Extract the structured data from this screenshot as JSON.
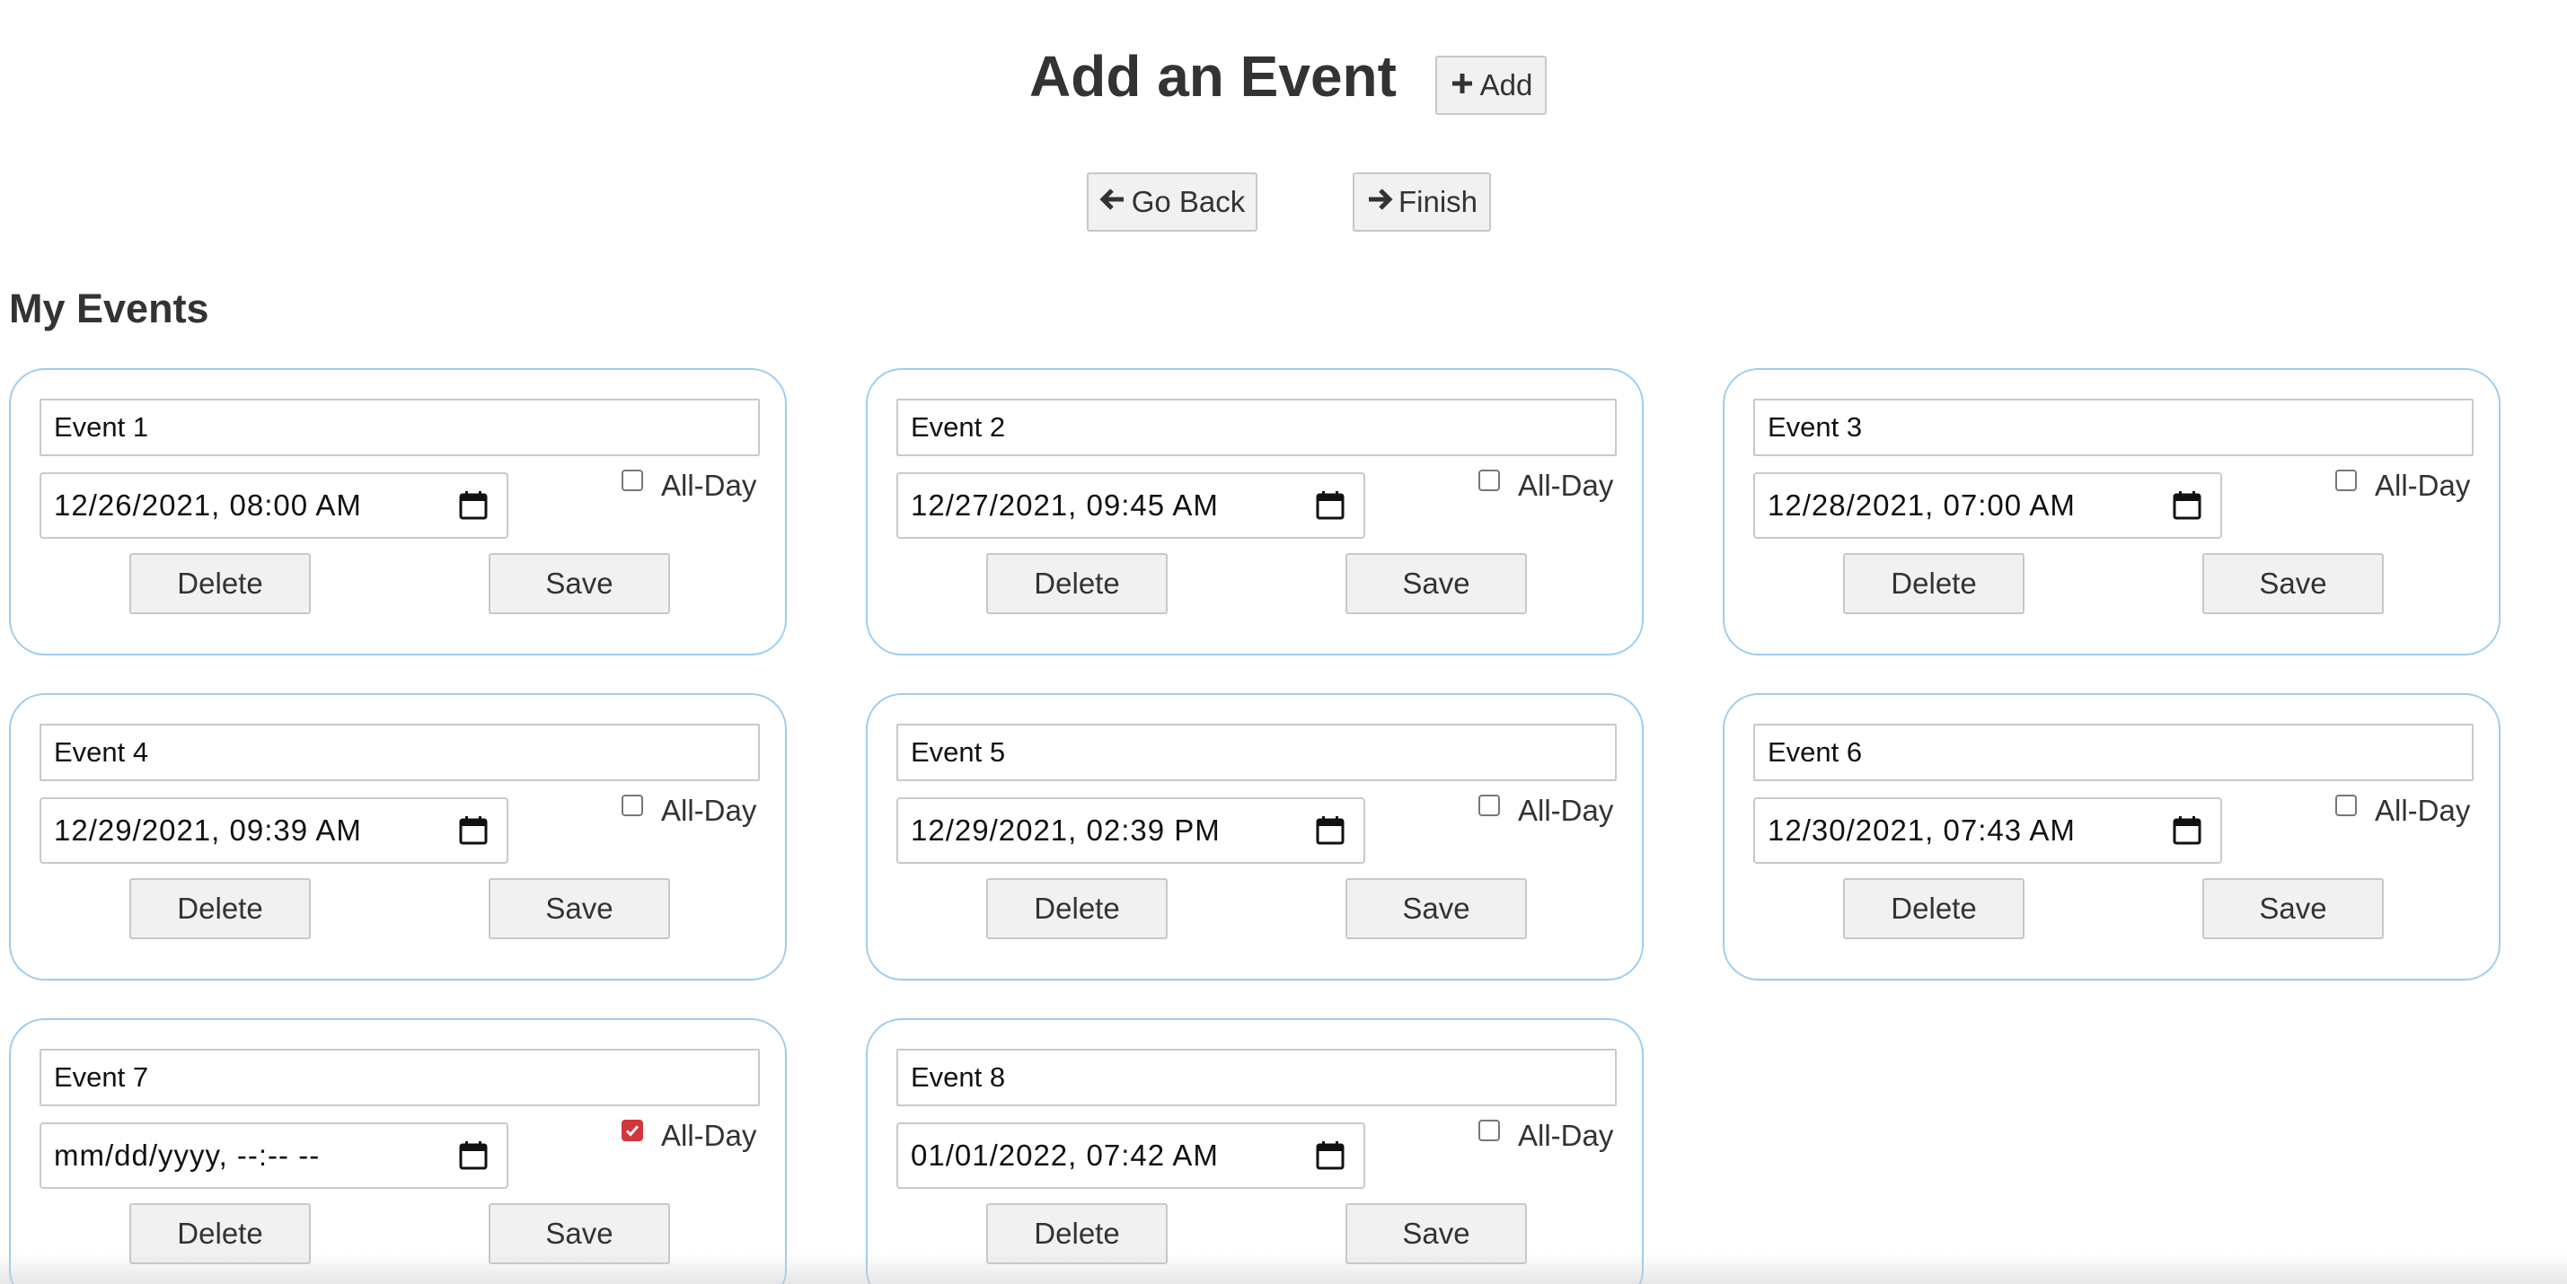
{
  "header": {
    "title": "Add an Event",
    "add_label": "Add",
    "go_back_label": "Go Back",
    "finish_label": "Finish"
  },
  "events_section": {
    "title": "My Events",
    "all_day_label": "All-Day",
    "delete_label": "Delete",
    "save_label": "Save",
    "events": [
      {
        "name": "Event 1",
        "datetime": "12/26/2021, 08:00 AM",
        "all_day": false
      },
      {
        "name": "Event 2",
        "datetime": "12/27/2021, 09:45 AM",
        "all_day": false
      },
      {
        "name": "Event 3",
        "datetime": "12/28/2021, 07:00 AM",
        "all_day": false
      },
      {
        "name": "Event 4",
        "datetime": "12/29/2021, 09:39 AM",
        "all_day": false
      },
      {
        "name": "Event 5",
        "datetime": "12/29/2021, 02:39 PM",
        "all_day": false
      },
      {
        "name": "Event 6",
        "datetime": "12/30/2021, 07:43 AM",
        "all_day": false
      },
      {
        "name": "Event 7",
        "datetime": "mm/dd/yyyy, --:-- --",
        "all_day": true
      },
      {
        "name": "Event 8",
        "datetime": "01/01/2022, 07:42 AM",
        "all_day": false
      }
    ]
  },
  "colors": {
    "card_border": "#9fcdee",
    "checkbox_checked": "#d0363b",
    "button_bg": "#f1f1f1",
    "text": "#333333"
  },
  "icons": {
    "add": "plus-icon",
    "go_back": "arrow-left-icon",
    "finish": "arrow-right-icon",
    "date": "calendar-icon"
  }
}
